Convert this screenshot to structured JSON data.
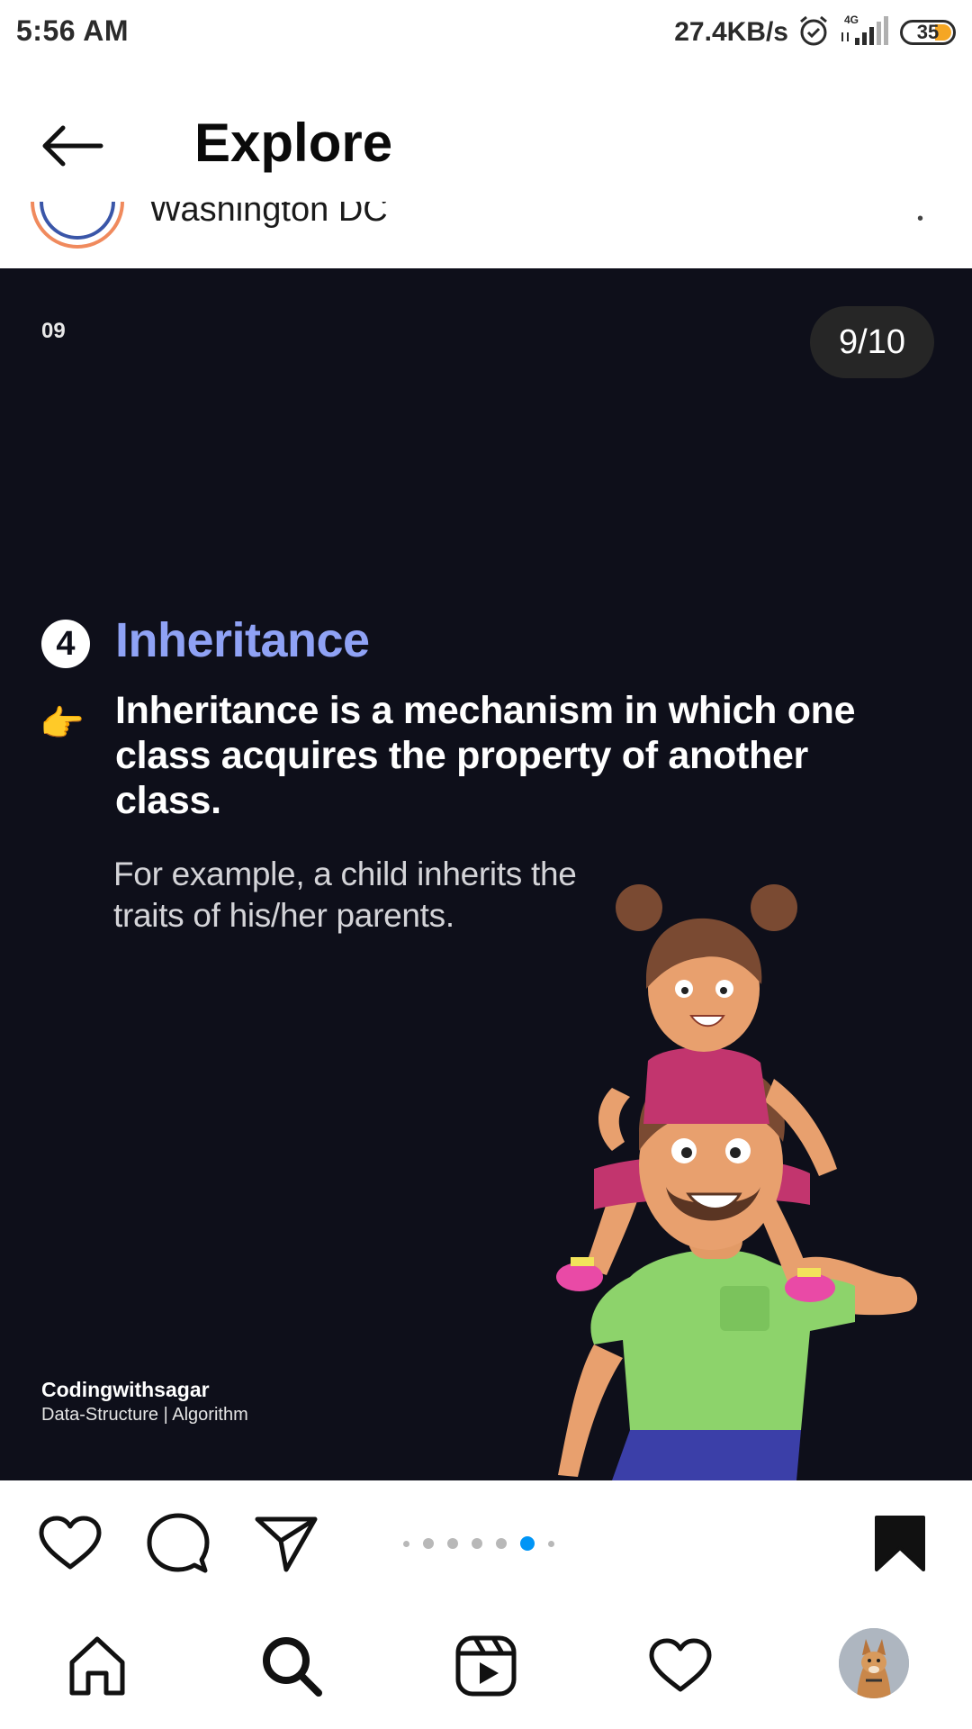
{
  "status_bar": {
    "time": "5:56 AM",
    "network_speed": "27.4KB/s",
    "network_type": "4G",
    "battery": "35",
    "icons": [
      "alarm-icon",
      "signal-icon",
      "battery-icon"
    ]
  },
  "header": {
    "title": "Explore",
    "back_icon": "arrow-left-icon"
  },
  "post": {
    "location": "Washington DC",
    "slide": {
      "number_label": "09",
      "counter": "9/10",
      "point_number": "4",
      "heading": "Inheritance",
      "pointer_emoji": "👉",
      "definition": "Inheritance is a mechanism in which one class acquires the property of another class.",
      "example": "For example, a child inherits the traits of his/her parents.",
      "brand_name": "Codingwithsagar",
      "brand_tagline": "Data-Structure | Algorithm",
      "heading_color": "#8fa2f5",
      "background_color": "#0e0f1a"
    },
    "carousel": {
      "total_dots": 7,
      "active_index": 5,
      "active_color": "#0095f6"
    }
  },
  "actions": {
    "icons": [
      "heart-icon",
      "comment-icon",
      "share-icon",
      "bookmark-icon"
    ]
  },
  "bottom_nav": {
    "icons": [
      "home-icon",
      "search-icon",
      "reels-icon",
      "activity-heart-icon",
      "profile-avatar"
    ]
  }
}
